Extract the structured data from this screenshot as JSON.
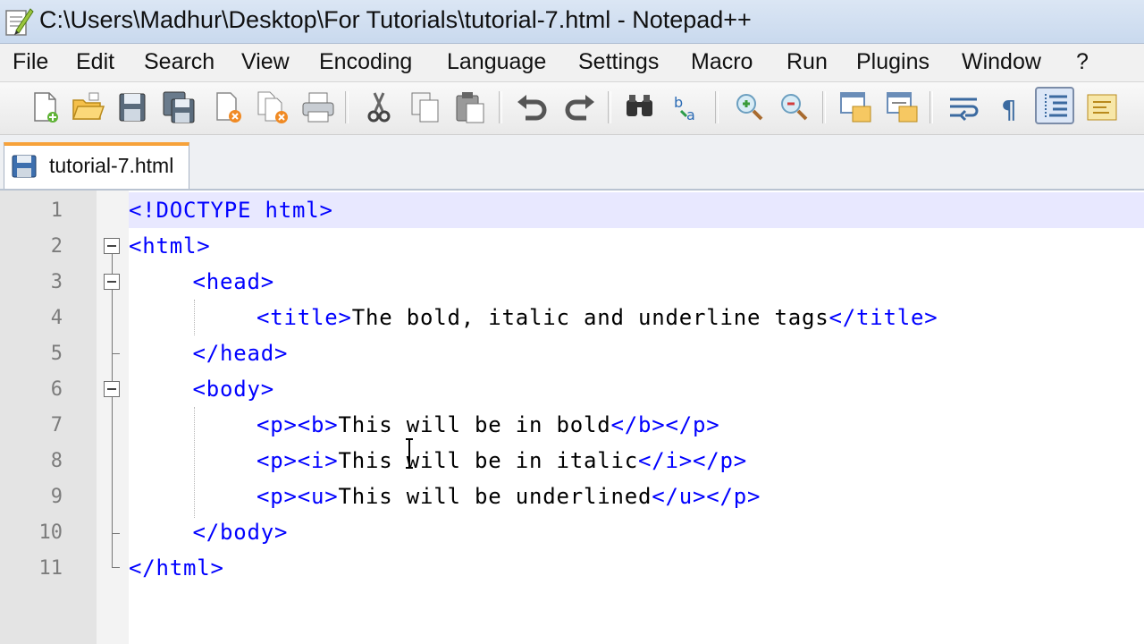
{
  "window": {
    "title": "C:\\Users\\Madhur\\Desktop\\For Tutorials\\tutorial-7.html - Notepad++"
  },
  "menu": [
    "File",
    "Edit",
    "Search",
    "View",
    "Encoding",
    "Language",
    "Settings",
    "Macro",
    "Run",
    "Plugins",
    "Window",
    "?"
  ],
  "toolbar": {
    "buttons": [
      "new-file-icon",
      "open-file-icon",
      "save-icon",
      "save-all-icon",
      "close-icon",
      "close-all-icon",
      "print-icon",
      "cut-icon",
      "copy-icon",
      "paste-icon",
      "undo-icon",
      "redo-icon",
      "find-icon",
      "replace-icon",
      "zoom-in-icon",
      "zoom-out-icon",
      "sync-vertical-icon",
      "sync-horizontal-icon",
      "word-wrap-icon",
      "show-all-characters-icon",
      "indent-guide-icon",
      "user-language-icon"
    ],
    "active_button": "indent-guide-icon"
  },
  "tabs": [
    {
      "label": "tutorial-7.html",
      "active": true
    }
  ],
  "editor": {
    "current_line": 1,
    "lines": [
      {
        "num": "1",
        "parts": [
          {
            "t": "tag",
            "v": "<!DOCTYPE html>"
          }
        ]
      },
      {
        "num": "2",
        "parts": [
          {
            "t": "tag",
            "v": "<html>"
          }
        ]
      },
      {
        "num": "3",
        "parts": [
          {
            "t": "tag",
            "v": "<head>"
          }
        ]
      },
      {
        "num": "4",
        "parts": [
          {
            "t": "tag",
            "v": "<title>"
          },
          {
            "t": "txt",
            "v": "The bold, italic and underline tags"
          },
          {
            "t": "tag",
            "v": "</title>"
          }
        ]
      },
      {
        "num": "5",
        "parts": [
          {
            "t": "tag",
            "v": "</head>"
          }
        ]
      },
      {
        "num": "6",
        "parts": [
          {
            "t": "tag",
            "v": "<body>"
          }
        ]
      },
      {
        "num": "7",
        "parts": [
          {
            "t": "tag",
            "v": "<p><b>"
          },
          {
            "t": "txt",
            "v": "This will be in bold"
          },
          {
            "t": "tag",
            "v": "</b></p>"
          }
        ]
      },
      {
        "num": "8",
        "parts": [
          {
            "t": "tag",
            "v": "<p><i>"
          },
          {
            "t": "txt",
            "v": "This will be in italic"
          },
          {
            "t": "tag",
            "v": "</i></p>"
          }
        ]
      },
      {
        "num": "9",
        "parts": [
          {
            "t": "tag",
            "v": "<p><u>"
          },
          {
            "t": "txt",
            "v": "This will be underlined"
          },
          {
            "t": "tag",
            "v": "</u></p>"
          }
        ]
      },
      {
        "num": "10",
        "parts": [
          {
            "t": "tag",
            "v": "</body>"
          }
        ]
      },
      {
        "num": "11",
        "parts": [
          {
            "t": "tag",
            "v": "</html>"
          }
        ]
      }
    ]
  },
  "colors": {
    "tag": "#0000ff",
    "text": "#000000",
    "line_number": "#7c7c7c",
    "current_line": "#e8e8ff",
    "tab_accent": "#f7a23a"
  }
}
